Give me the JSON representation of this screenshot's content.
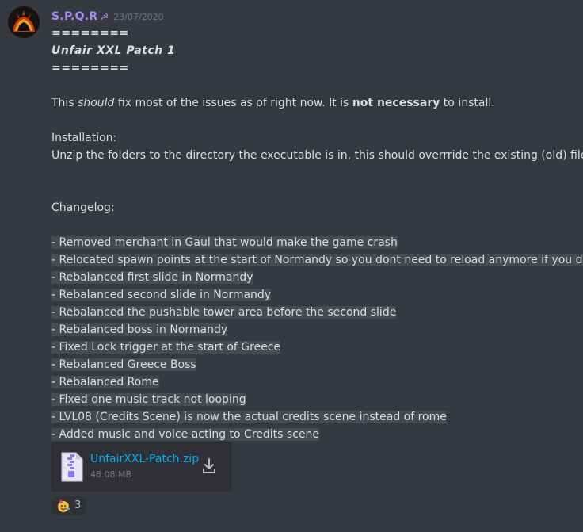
{
  "message": {
    "author": "S.P.Q.R",
    "author_badge": "☭",
    "timestamp": "23/07/2020",
    "header_lines": [
      "========",
      "Unfair XXL  Patch 1",
      "========"
    ],
    "intro": {
      "pre": "This ",
      "em": "should",
      "mid": " fix most of the issues as of right now. It is ",
      "strong": "not necessary",
      "post": " to install."
    },
    "installation_label": "Installation:",
    "installation_text": "Unzip the folders to the directory the executable is in, this should overrride the existing (old) files.",
    "changelog_label": "Changelog:",
    "changelog": [
      "- Removed merchant in Gaul that would make the game crash",
      "- Relocated spawn points at the start of Normandy so you dont need to reload anymore if you die",
      "- Rebalanced first slide in Normandy",
      "- Rebalanced second slide in Normandy",
      "- Rebalanced the pushable tower area before the second slide",
      "- Rebalanced boss in Normandy",
      "- Fixed Lock trigger at the start of Greece",
      "- Rebalanced Greece Boss",
      "- Rebalanced Rome",
      "- Fixed one music track not looping",
      "- LVL08 (Credits Scene) is now the actual credits scene instead of rome",
      "- Added music and voice acting to Credits scene"
    ],
    "attachment": {
      "file_name": "UnfairXXL-Patch.zip",
      "file_size": "48.08 MB",
      "icon": "zip-file-icon",
      "action_icon": "download-icon"
    },
    "reaction": {
      "emoji": "🥳",
      "count": "3"
    }
  },
  "colors": {
    "background": "#36393f",
    "username": "#a98bf5",
    "link": "#00b0f4",
    "text": "#dcddde",
    "highlight": "#474a51"
  }
}
